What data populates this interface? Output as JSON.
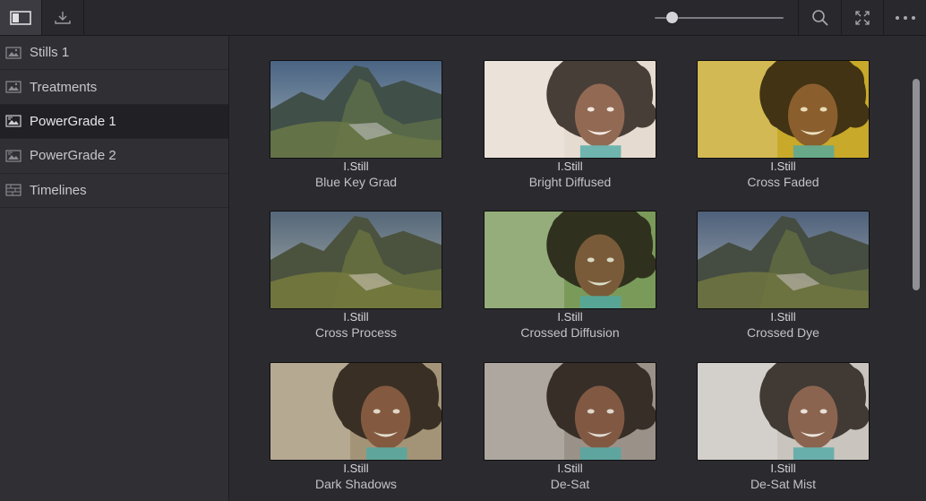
{
  "toolbar": {
    "buttons": [
      {
        "name": "sidebar-toggle-icon"
      },
      {
        "name": "import-icon"
      },
      {
        "name": "search-icon"
      },
      {
        "name": "fullscreen-icon"
      },
      {
        "name": "more-options-icon"
      }
    ],
    "zoom_slider_value": 0.13
  },
  "sidebar": {
    "items": [
      {
        "label": "Stills 1",
        "icon": "stills-album-icon"
      },
      {
        "label": "Treatments",
        "icon": "stills-album-icon"
      },
      {
        "label": "PowerGrade 1",
        "icon": "powergrade-album-icon"
      },
      {
        "label": "PowerGrade 2",
        "icon": "powergrade-album-icon"
      },
      {
        "label": "Timelines",
        "icon": "timeline-album-icon"
      }
    ],
    "selected": "PowerGrade 1"
  },
  "gallery": {
    "stills": [
      {
        "label": "I.Still",
        "name": "Blue Key Grad",
        "subject": "mountain",
        "tint": "#4d6a8a"
      },
      {
        "label": "I.Still",
        "name": "Bright Diffused",
        "subject": "portrait",
        "tint": "#e6dcd0"
      },
      {
        "label": "I.Still",
        "name": "Cross Faded",
        "subject": "portrait",
        "tint": "#c8a92a"
      },
      {
        "label": "I.Still",
        "name": "Cross Process",
        "subject": "mountain",
        "tint": "#8a7a55"
      },
      {
        "label": "I.Still",
        "name": "Crossed Diffusion",
        "subject": "portrait",
        "tint": "#7a9a5a"
      },
      {
        "label": "I.Still",
        "name": "Crossed Dye",
        "subject": "mountain",
        "tint": "#6a5a66"
      },
      {
        "label": "I.Still",
        "name": "Dark Shadows",
        "subject": "portrait",
        "tint": "#a59478"
      },
      {
        "label": "I.Still",
        "name": "De-Sat",
        "subject": "portrait",
        "tint": "#9a938a"
      },
      {
        "label": "I.Still",
        "name": "De-Sat Mist",
        "subject": "portrait",
        "tint": "#c9c5bd"
      }
    ]
  }
}
